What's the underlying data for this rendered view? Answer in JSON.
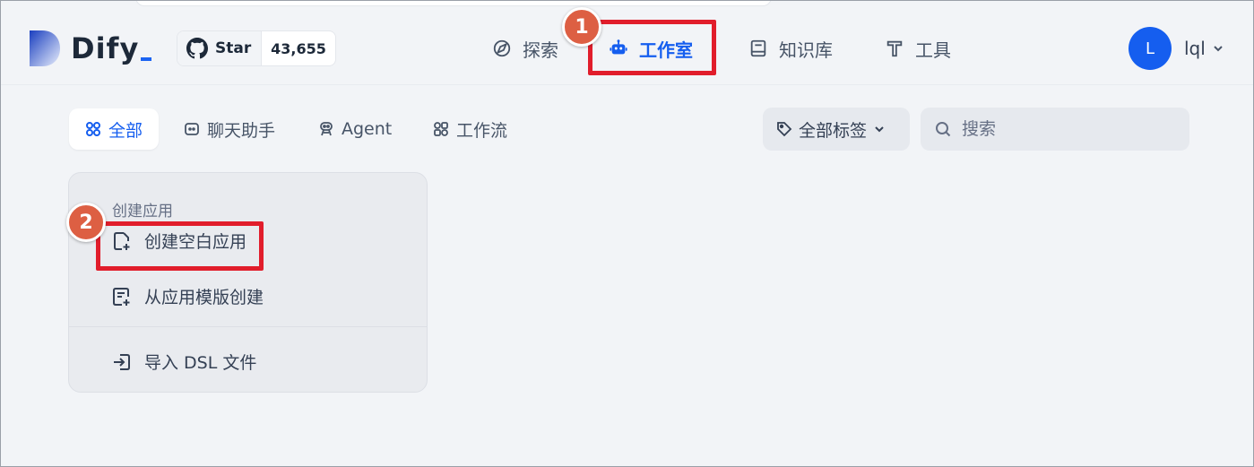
{
  "brand": {
    "name": "Dify",
    "accent": "#155eef"
  },
  "github": {
    "star_label": "Star",
    "star_count": "43,655"
  },
  "nav": {
    "explore": "探索",
    "studio": "工作室",
    "knowledge": "知识库",
    "tools": "工具",
    "active": "studio"
  },
  "user": {
    "initial": "L",
    "name": "lql"
  },
  "filters": {
    "tabs": [
      "全部",
      "聊天助手",
      "Agent",
      "工作流"
    ],
    "active": "全部",
    "tag_filter": "全部标签",
    "search_placeholder": "搜索"
  },
  "create_card": {
    "title": "创建应用",
    "blank": "创建空白应用",
    "from_template": "从应用模版创建",
    "import_dsl": "导入 DSL 文件"
  },
  "annotations": {
    "badge_1": "1",
    "badge_2": "2",
    "color": "#e11d2b"
  }
}
